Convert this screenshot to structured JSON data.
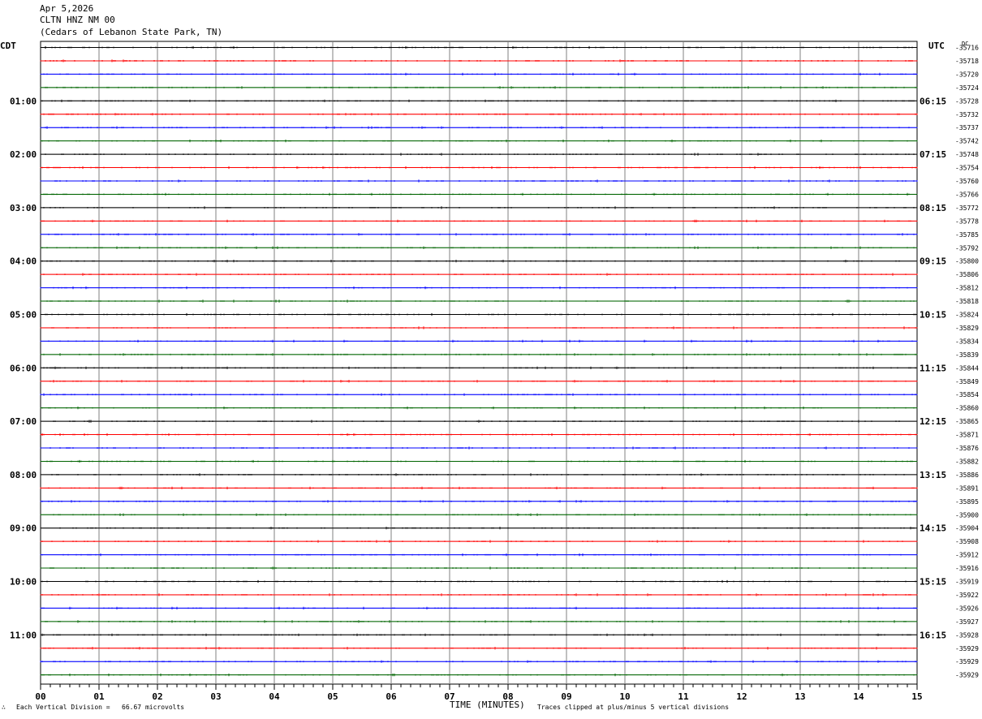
{
  "header": {
    "date": "Apr 5,2026",
    "station": "CLTN HNZ NM 00",
    "location": "(Cedars of Lebanon State Park, TN)"
  },
  "left_axis_label": "CDT",
  "right_axis_label": "UTC",
  "dc_label": "DC",
  "footer": {
    "scale_note": "Each Vertical Division =   66.67 microvolts",
    "x_title": "TIME (MINUTES)",
    "clip_note": "Traces clipped at plus/minus 5 vertical divisions",
    "corner_mark": "∴"
  },
  "chart_data": {
    "type": "line",
    "title": "CLTN HNZ NM 00",
    "xlabel": "TIME (MINUTES)",
    "xlim": [
      0,
      15
    ],
    "x_ticks": [
      "00",
      "01",
      "02",
      "03",
      "04",
      "05",
      "06",
      "07",
      "08",
      "09",
      "10",
      "11",
      "12",
      "13",
      "14",
      "15"
    ],
    "rows": 48,
    "row_minutes": 15,
    "trace_colors": [
      "#000000",
      "#ff0000",
      "#0000ff",
      "#006400"
    ],
    "grid": true,
    "cdt_hour_labels": [
      "01:00",
      "02:00",
      "03:00",
      "04:00",
      "05:00",
      "06:00",
      "07:00",
      "08:00",
      "09:00",
      "10:00",
      "11:00"
    ],
    "utc_hour_labels": [
      "06:15",
      "07:15",
      "08:15",
      "09:15",
      "10:15",
      "11:15",
      "12:15",
      "13:15",
      "14:15",
      "15:15",
      "16:15"
    ],
    "hour_label_row_offset": 4,
    "dc_offsets": [
      "-35716",
      "-35718",
      "-35720",
      "-35724",
      "-35728",
      "-35732",
      "-35737",
      "-35742",
      "-35748",
      "-35754",
      "-35760",
      "-35766",
      "-35772",
      "-35778",
      "-35785",
      "-35792",
      "-35800",
      "-35806",
      "-35812",
      "-35818",
      "-35824",
      "-35829",
      "-35834",
      "-35839",
      "-35844",
      "-35849",
      "-35854",
      "-35860",
      "-35865",
      "-35871",
      "-35876",
      "-35882",
      "-35886",
      "-35891",
      "-35895",
      "-35900",
      "-35904",
      "-35908",
      "-35912",
      "-35916",
      "-35919",
      "-35922",
      "-35926",
      "-35927",
      "-35928",
      "-35929",
      "-35929",
      "-35929"
    ]
  }
}
